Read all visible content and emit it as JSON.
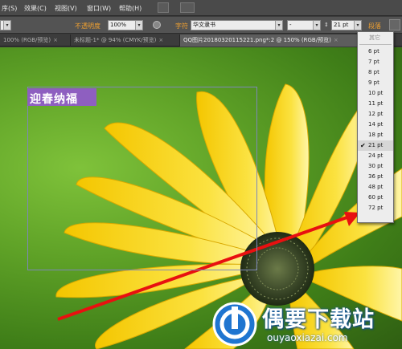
{
  "menubar": {
    "items": [
      "序(S)",
      "效果(C)",
      "视图(V)",
      "窗口(W)",
      "帮助(H)"
    ]
  },
  "options": {
    "opacity_label": "不透明度",
    "opacity_value": "100%",
    "font_label": "字符",
    "font_value": "华文隶书",
    "style_value": "-",
    "size_value": "21 pt",
    "paragraph_label": "段落"
  },
  "tabs": [
    {
      "label": "100% (RGB/预览)"
    },
    {
      "label": "未标题-1* @ 94% (CMYK/预览)"
    },
    {
      "label": "QQ图片20180320115221.png*:2 @ 150% (RGB/预览)"
    }
  ],
  "font_size_menu": {
    "header": "其它",
    "items": [
      "6 pt",
      "7 pt",
      "8 pt",
      "9 pt",
      "10 pt",
      "11 pt",
      "12 pt",
      "14 pt",
      "18 pt",
      "21 pt",
      "24 pt",
      "30 pt",
      "36 pt",
      "48 pt",
      "60 pt",
      "72 pt"
    ],
    "selected": "21 pt"
  },
  "canvas": {
    "text_object": "迎春纳福"
  },
  "watermark": {
    "title": "偶要下载站",
    "url": "ouyaoxiazai.com"
  },
  "colors": {
    "arrow": "#e81010",
    "accent_label": "#f0a030",
    "text_frame": "#8e5fc0",
    "petal": "#f7d21a",
    "center": "#3d4a2a"
  }
}
